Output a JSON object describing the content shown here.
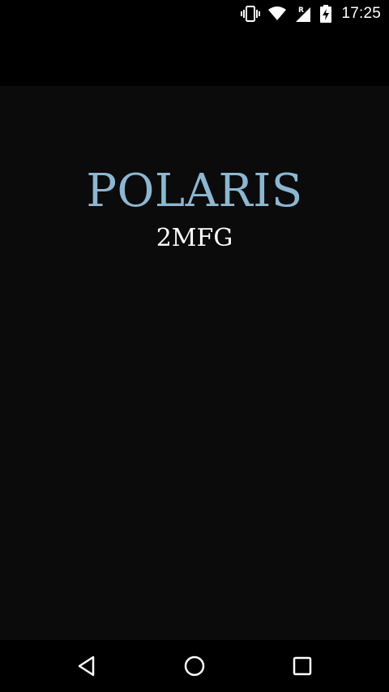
{
  "status_bar": {
    "time": "17:25",
    "icons": [
      "vibrate-icon",
      "wifi-icon",
      "signal-roaming-icon",
      "battery-charging-icon"
    ],
    "roaming_label": "R"
  },
  "splash": {
    "title": "POLARIS",
    "subtitle": "2MFG",
    "title_color": "#8ab8d3",
    "subtitle_color": "#ffffff",
    "background": "#0b0b0b"
  },
  "nav_bar": {
    "buttons": [
      "back-icon",
      "home-icon",
      "recents-icon"
    ]
  }
}
